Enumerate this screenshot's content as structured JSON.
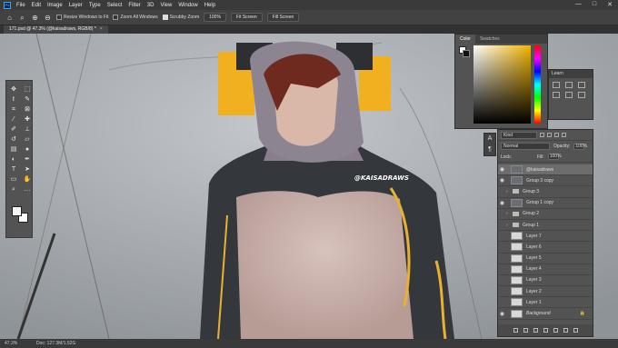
{
  "app": {
    "logo_text": "Ps"
  },
  "menu": [
    "File",
    "Edit",
    "Image",
    "Layer",
    "Type",
    "Select",
    "Filter",
    "3D",
    "View",
    "Window",
    "Help"
  ],
  "window_controls": {
    "minimize": "—",
    "maximize": "□",
    "close": "✕"
  },
  "options": {
    "resize_windows": "Resize Windows to Fit",
    "zoom_all": "Zoom All Windows",
    "scrubby_zoom": "Scrubby Zoom",
    "zoom_value": "100%",
    "fit_screen": "Fit Screen",
    "fill_screen": "Fill Screen"
  },
  "document_tab": {
    "title": "171.psd @ 47.3% (@kaisadraws, RGB/8) *",
    "close": "×"
  },
  "watermark": "@KAISADRAWS",
  "color_panel": {
    "tabs": [
      "Color",
      "Swatches"
    ],
    "accent": "#f0b400"
  },
  "learn_panel": {
    "title": "Learn"
  },
  "layers_panel": {
    "kind": "Kind",
    "blend_mode": "Normal",
    "opacity_label": "Opacity:",
    "opacity_value": "100%",
    "lock_label": "Lock:",
    "fill_label": "Fill:",
    "fill_value": "100%",
    "layers": [
      {
        "name": "@kaisadraws",
        "visible": true,
        "type": "text",
        "selected": true
      },
      {
        "name": "Group 3 copy",
        "visible": true,
        "type": "layer"
      },
      {
        "name": "Group 3",
        "visible": false,
        "type": "group"
      },
      {
        "name": "Group 1 copy",
        "visible": true,
        "type": "layer"
      },
      {
        "name": "Group 2",
        "visible": false,
        "type": "group"
      },
      {
        "name": "Group 1",
        "visible": false,
        "type": "group"
      },
      {
        "name": "Layer 7",
        "visible": false,
        "type": "layer"
      },
      {
        "name": "Layer 6",
        "visible": false,
        "type": "layer"
      },
      {
        "name": "Layer 5",
        "visible": false,
        "type": "layer"
      },
      {
        "name": "Layer 4",
        "visible": false,
        "type": "layer"
      },
      {
        "name": "Layer 3",
        "visible": false,
        "type": "layer"
      },
      {
        "name": "Layer 2",
        "visible": false,
        "type": "layer"
      },
      {
        "name": "Layer 1",
        "visible": false,
        "type": "layer"
      },
      {
        "name": "Background",
        "visible": true,
        "type": "layer",
        "locked": true
      }
    ]
  },
  "status": {
    "zoom": "47.3%",
    "doc": "Doc: 127.3M/1.52G"
  }
}
